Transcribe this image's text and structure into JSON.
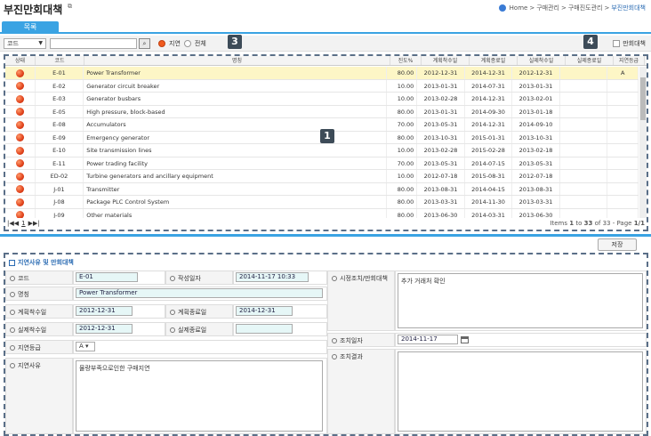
{
  "header": {
    "title": "부진만회대책",
    "title_icon": "new-window-icon",
    "breadcrumb": [
      "Home",
      "구매관리",
      "구매진도관리",
      "부진만회대책"
    ],
    "breadcrumb_seps": [
      ">",
      ">",
      ">"
    ]
  },
  "tabs": [
    {
      "label": "목록"
    }
  ],
  "toolbar": {
    "select_value": "코드",
    "search_value": "",
    "radio_delay": "지연",
    "radio_all": "전체",
    "checkbox_label": "만회대책"
  },
  "badges": {
    "b1": "1",
    "b3": "3",
    "b4": "4"
  },
  "grid": {
    "headers": [
      "상태",
      "코드",
      "명칭",
      "진도%",
      "계획착수일",
      "계획종료일",
      "실제착수일",
      "실제종료일",
      "지연등급"
    ],
    "rows": [
      {
        "code": "E-01",
        "name": "Power Transformer",
        "pct": "80.00",
        "plan_start": "2012-12-31",
        "plan_end": "2014-12-31",
        "actual_start": "2012-12-31",
        "actual_end": "",
        "grade": "A"
      },
      {
        "code": "E-02",
        "name": "Generator circuit breaker",
        "pct": "10.00",
        "plan_start": "2013-01-31",
        "plan_end": "2014-07-31",
        "actual_start": "2013-01-31",
        "actual_end": "",
        "grade": ""
      },
      {
        "code": "E-03",
        "name": "Generator busbars",
        "pct": "10.00",
        "plan_start": "2013-02-28",
        "plan_end": "2014-12-31",
        "actual_start": "2013-02-01",
        "actual_end": "",
        "grade": ""
      },
      {
        "code": "E-05",
        "name": "High pressure, block-based",
        "pct": "80.00",
        "plan_start": "2013-01-31",
        "plan_end": "2014-09-30",
        "actual_start": "2013-01-18",
        "actual_end": "",
        "grade": ""
      },
      {
        "code": "E-08",
        "name": "Accumulators",
        "pct": "70.00",
        "plan_start": "2013-05-31",
        "plan_end": "2014-12-31",
        "actual_start": "2014-09-10",
        "actual_end": "",
        "grade": ""
      },
      {
        "code": "E-09",
        "name": "Emergency generator",
        "pct": "80.00",
        "plan_start": "2013-10-31",
        "plan_end": "2015-01-31",
        "actual_start": "2013-10-31",
        "actual_end": "",
        "grade": ""
      },
      {
        "code": "E-10",
        "name": "Site transmission lines",
        "pct": "10.00",
        "plan_start": "2013-02-28",
        "plan_end": "2015-02-28",
        "actual_start": "2013-02-18",
        "actual_end": "",
        "grade": ""
      },
      {
        "code": "E-11",
        "name": "Power trading facility",
        "pct": "70.00",
        "plan_start": "2013-05-31",
        "plan_end": "2014-07-15",
        "actual_start": "2013-05-31",
        "actual_end": "",
        "grade": ""
      },
      {
        "code": "ED-02",
        "name": "Turbine generators and ancillary equipment",
        "pct": "10.00",
        "plan_start": "2012-07-18",
        "plan_end": "2015-08-31",
        "actual_start": "2012-07-18",
        "actual_end": "",
        "grade": ""
      },
      {
        "code": "J-01",
        "name": "Transmitter",
        "pct": "80.00",
        "plan_start": "2013-08-31",
        "plan_end": "2014-04-15",
        "actual_start": "2013-08-31",
        "actual_end": "",
        "grade": ""
      },
      {
        "code": "J-08",
        "name": "Package PLC Control System",
        "pct": "80.00",
        "plan_start": "2013-03-31",
        "plan_end": "2014-11-30",
        "actual_start": "2013-03-31",
        "actual_end": "",
        "grade": ""
      },
      {
        "code": "J-09",
        "name": "Other materials",
        "pct": "80.00",
        "plan_start": "2013-06-30",
        "plan_end": "2014-03-31",
        "actual_start": "2013-06-30",
        "actual_end": "",
        "grade": ""
      }
    ]
  },
  "pager": {
    "first": "|◀◀",
    "page": "1",
    "last": "▶▶|",
    "info_prefix": "Items",
    "info_from": "1",
    "info_to_word": "to",
    "info_to": "33",
    "info_of_word": "of",
    "info_total": "33",
    "info_page": "- Page",
    "info_page_val": "1/1"
  },
  "actions": {
    "save_label": "저장"
  },
  "form": {
    "section_title": "지연사유 및 만회대책",
    "code_label": "코드",
    "code_value": "E-01",
    "created_label": "작성일자",
    "created_value": "2014-11-17 10:33",
    "name_label": "명칭",
    "name_value": "Power Transformer",
    "plan_start_label": "계획착수일",
    "plan_start_value": "2012-12-31",
    "plan_end_label": "계획종료일",
    "plan_end_value": "2014-12-31",
    "actual_start_label": "실제착수일",
    "actual_start_value": "2012-12-31",
    "actual_end_label": "실제종료일",
    "actual_end_value": "",
    "grade_label": "지연등급",
    "grade_value": "A",
    "reason_label": "지연사유",
    "reason_value": "물량부족으로인한 구매지연",
    "measure_label": "시정조치/만회대책",
    "measure_value": "추가 거래처 확인",
    "action_date_label": "조치일자",
    "action_date_value": "2014-11-17",
    "action_result_label": "조치결과",
    "action_result_value": ""
  }
}
